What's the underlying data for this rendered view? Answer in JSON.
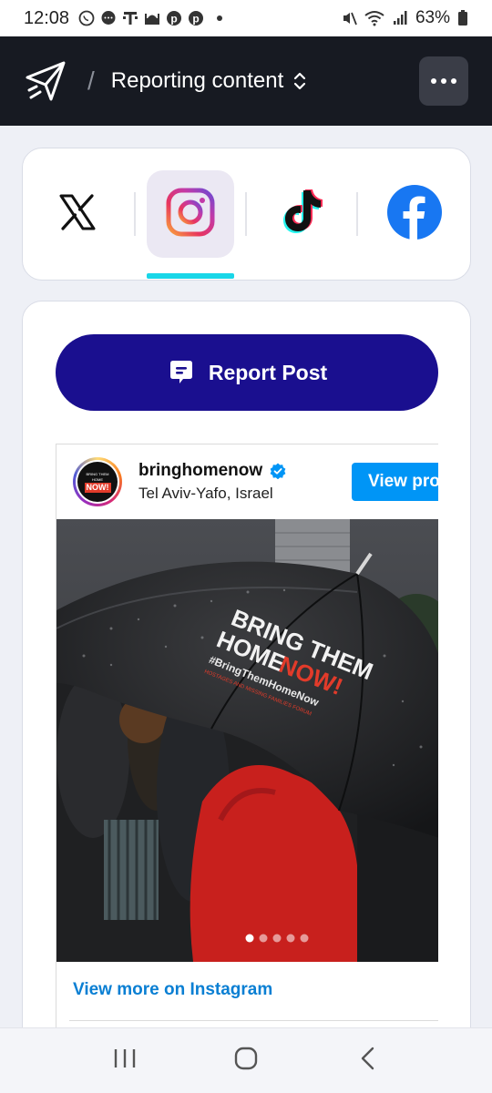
{
  "status_bar": {
    "time": "12:08",
    "battery": "63%",
    "icons": [
      "whatsapp-icon",
      "chat-icon",
      "t-mobile-icon",
      "mosque-icon",
      "pinterest-icon",
      "pinterest-icon",
      "dot-icon"
    ],
    "right_icons": [
      "mute-icon",
      "wifi-icon",
      "signal-icon",
      "battery-icon"
    ]
  },
  "header": {
    "title": "Reporting content",
    "separator": "/"
  },
  "platforms": [
    {
      "name": "X",
      "icon": "x-logo-icon",
      "active": false
    },
    {
      "name": "Instagram",
      "icon": "instagram-logo-icon",
      "active": true
    },
    {
      "name": "TikTok",
      "icon": "tiktok-logo-icon",
      "active": false
    },
    {
      "name": "Facebook",
      "icon": "facebook-logo-icon",
      "active": false
    }
  ],
  "report_button": {
    "label": "Report Post"
  },
  "instagram_post": {
    "username": "bringhomenow",
    "location": "Tel Aviv-Yafo, Israel",
    "view_profile_label": "View pro",
    "avatar_text_small": "BRING THEM HOME",
    "avatar_text_now": "NOW!",
    "umbrella_line1": "BRING THEM",
    "umbrella_line2a": "HOME",
    "umbrella_line2b": "NOW!",
    "umbrella_hashtag": "#BringThemHomeNow",
    "umbrella_forum": "HOSTAGES AND MISSING FAMILIES FORUM",
    "carousel_count": 5,
    "carousel_active": 0,
    "view_more_label": "View more on Instagram"
  },
  "colors": {
    "header_bg": "#171a22",
    "report_button": "#1a0f8f",
    "active_tab_underline": "#19d6e8",
    "instagram_blue": "#0095f6",
    "link_blue": "#0a7fd3"
  }
}
